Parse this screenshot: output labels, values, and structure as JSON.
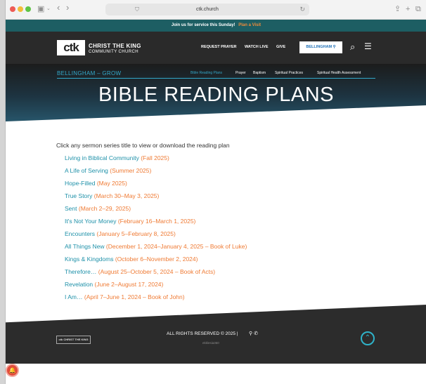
{
  "browser": {
    "url": "ctk.church",
    "icons": {
      "sidebar": "sidebar-icon",
      "back": "chevron-left-icon",
      "forward": "chevron-right-icon",
      "share": "share-icon",
      "new_tab": "plus-icon",
      "tabs": "tabs-icon"
    }
  },
  "announcement": {
    "text": "Join us for service this Sunday!",
    "cta": "Plan a Visit"
  },
  "header": {
    "logo_mark": "ctk",
    "logo_line1": "CHRIST THE KING",
    "logo_line2": "COMMUNITY CHURCH",
    "nav": [
      "REQUEST PRAYER",
      "WATCH LIVE",
      "GIVE"
    ],
    "location_button": "BELLINGHAM"
  },
  "hero": {
    "breadcrumb": "BELLINGHAM – GROW",
    "subnav": [
      "Bible Reading Plans",
      "Prayer",
      "Baptism",
      "Spiritual Practices",
      "Spiritual Health Assessment"
    ],
    "title": "BIBLE READING PLANS"
  },
  "content": {
    "intro": "Click any sermon series title to view or download the reading plan",
    "plans": [
      {
        "title": "Living in Biblical Community",
        "date": "(Fall 2025)"
      },
      {
        "title": "A Life of Serving",
        "date": "(Summer 2025)"
      },
      {
        "title": "Hope-Filled",
        "date": "(May 2025)"
      },
      {
        "title": "True Story",
        "date": "(March 30–May 3, 2025)"
      },
      {
        "title": "Sent",
        "date": "(March 2–29, 2025)"
      },
      {
        "title": "It's Not Your Money",
        "date": "(February 16–March 1, 2025)"
      },
      {
        "title": "Encounters",
        "date": "(January 5–February 8, 2025)"
      },
      {
        "title": "All Things New",
        "date": "(December 1, 2024–January 4, 2025 – Book of Luke)"
      },
      {
        "title": "Kings & Kingdoms",
        "date": "(October 6–November 2, 2024)"
      },
      {
        "title": "Therefore…",
        "date": "(August 25–October 5, 2024 – Book of Acts)"
      },
      {
        "title": "Revelation",
        "date": "(June 2–August 17, 2024)"
      },
      {
        "title": "I Am…",
        "date": "(April 7–June 1, 2024 – Book of John)"
      }
    ]
  },
  "footer": {
    "logo_text": "ctk CHRIST THE KING",
    "copyright": "ALL RIGHTS RESERVED © 2025",
    "separator": "|",
    "credit": "ekklesia360"
  },
  "colors": {
    "announcement_bg": "#1d5e63",
    "accent_orange": "#ef7a33",
    "link_teal": "#1f91a9",
    "hero_accent": "#33a8c9",
    "header_bg": "#2a2a2a"
  }
}
